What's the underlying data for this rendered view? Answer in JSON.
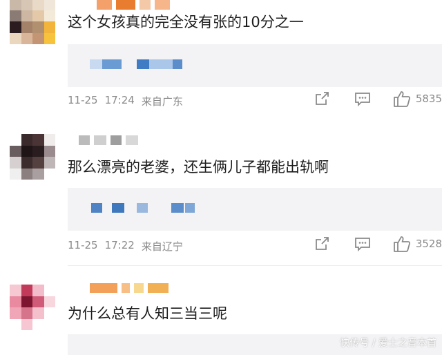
{
  "comments": [
    {
      "text": "这个女孩真的完全没有张的10分之一",
      "date": "11-25",
      "time": "17:24",
      "location": "来自广东",
      "likes": "5835",
      "avatar_colors": [
        "#c9b7a8",
        "#d8c6b5",
        "#e9d9c7",
        "#f0e6da",
        "#8a7b75",
        "#cdb7a3",
        "#e3c9a7",
        "#f4ead9",
        "#2b1d1f",
        "#a4826a",
        "#b1906f",
        "#f2b43a",
        "#ead7bd",
        "#d9b69a",
        "#c39574",
        "#f7c23c"
      ],
      "nick_colors": [
        "#f4a06a",
        "#e87c2f",
        "#f3c9a8",
        "#f7b58a"
      ],
      "repost_colors": [
        "#c8daf0",
        "#6a9bd3",
        "#3f7cc4",
        "#aac7ea",
        "#5b8dca"
      ]
    },
    {
      "text": "那么漂亮的老婆，还生俩儿子都能出轨啊",
      "date": "11-25",
      "time": "17:22",
      "location": "来自辽宁",
      "likes": "3528",
      "avatar_colors": [
        "#ffffff",
        "#3a2a2c",
        "#4a3436",
        "#f0ecec",
        "#6a5d5f",
        "#1f1516",
        "#2a1d1f",
        "#9a8c8e",
        "#d7d0d1",
        "#3c2c2e",
        "#54403f",
        "#bfb6b7",
        "#efefef",
        "#8c7f80",
        "#a99fa0",
        "#ffffff"
      ],
      "nick_colors": [
        "#bbbbbb",
        "#cfcfcf",
        "#9e9e9e",
        "#d8d8d8"
      ],
      "repost_colors": [
        "#4f83c4",
        "#3f78bd",
        "#9ab8de",
        "#5b8dca",
        "#7ea6d6"
      ]
    },
    {
      "text": "为什么总有人知三当三呢",
      "avatar_colors": [
        "#f5c8d2",
        "#c13a59",
        "#f3bccb",
        "#ffffff",
        "#e98aa1",
        "#7c1630",
        "#d05b78",
        "#f7d6de",
        "#f1a6b8",
        "#d6748c",
        "#f3c0cc",
        "#ffffff",
        "#ffffff",
        "#f6c7d2",
        "#ffffff",
        "#ffffff"
      ],
      "nick_colors": [
        "#f3a05a",
        "#f7bf86",
        "#f7d88e",
        "#f2b055"
      ]
    }
  ],
  "watermark": "快传号 / 爱士之音本首",
  "icons": {
    "share": "share-icon",
    "comment": "comment-icon",
    "like": "thumbs-up-icon"
  }
}
